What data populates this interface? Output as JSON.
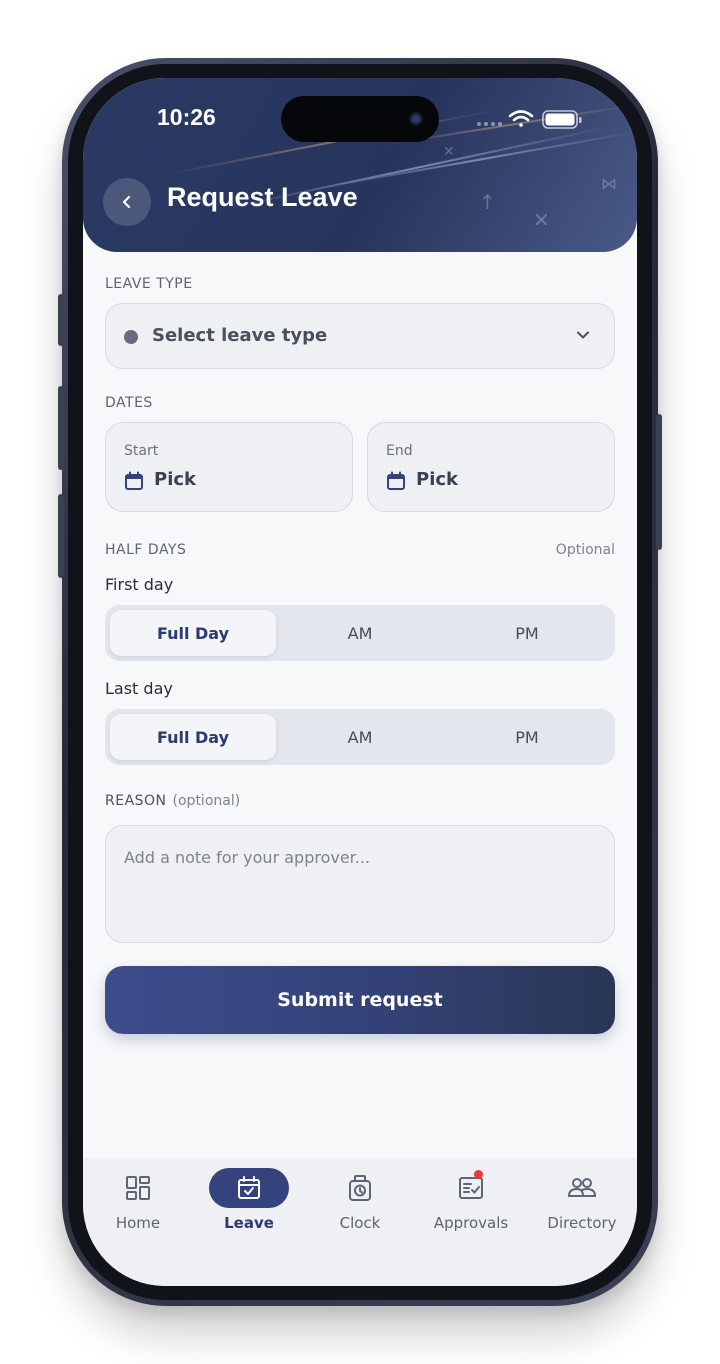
{
  "status_bar": {
    "time": "10:26"
  },
  "header": {
    "title": "Request Leave"
  },
  "leave_type": {
    "label": "LEAVE TYPE",
    "placeholder": "Select leave type"
  },
  "dates": {
    "label": "DATES",
    "start": {
      "label": "Start",
      "value": "Pick"
    },
    "end": {
      "label": "End",
      "value": "Pick"
    }
  },
  "half_days": {
    "label": "HALF DAYS",
    "optional": "Optional",
    "first_day": {
      "label": "First day",
      "options": [
        "Full Day",
        "AM",
        "PM"
      ],
      "selected": "Full Day"
    },
    "last_day": {
      "label": "Last day",
      "options": [
        "Full Day",
        "AM",
        "PM"
      ],
      "selected": "Full Day"
    }
  },
  "reason": {
    "label": "REASON",
    "optional": "(optional)",
    "placeholder": "Add a note for your approver..."
  },
  "submit": {
    "label": "Submit request"
  },
  "tabs": [
    {
      "label": "Home",
      "icon": "dashboard-icon",
      "active": false
    },
    {
      "label": "Leave",
      "icon": "calendar-check-icon",
      "active": true
    },
    {
      "label": "Clock",
      "icon": "time-clock-icon",
      "active": false
    },
    {
      "label": "Approvals",
      "icon": "approvals-icon",
      "active": false,
      "badge": true
    },
    {
      "label": "Directory",
      "icon": "people-icon",
      "active": false
    }
  ],
  "colors": {
    "header": "#27355c",
    "accent": "#34427e",
    "badge": "#e53935"
  }
}
